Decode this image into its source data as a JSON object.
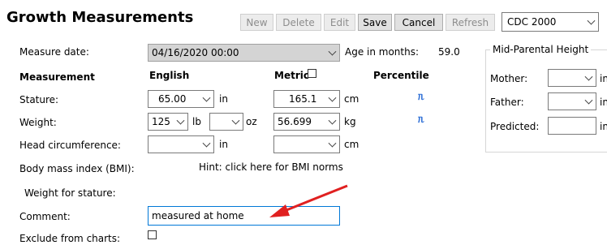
{
  "header": {
    "title": "Growth Measurements"
  },
  "toolbar": {
    "new": "New",
    "delete": "Delete",
    "edit": "Edit",
    "save": "Save",
    "cancel": "Cancel",
    "refresh": "Refresh",
    "standard": "CDC 2000"
  },
  "measure_date": {
    "label": "Measure date:",
    "value": "04/16/2020 00:00",
    "age_label": "Age in months:",
    "age_value": "59.0"
  },
  "columns": {
    "measurement": "Measurement",
    "english": "English",
    "metric": "Metric",
    "percentile": "Percentile"
  },
  "rows": {
    "stature": {
      "label": "Stature:",
      "english_value": "65.00",
      "english_unit": "in",
      "metric_value": "165.1",
      "metric_unit": "cm"
    },
    "weight": {
      "label": "Weight:",
      "english_value": "125",
      "english_unit": "lb",
      "english_value2": "",
      "english_unit2": "oz",
      "metric_value": "56.699",
      "metric_unit": "kg"
    },
    "head": {
      "label": "Head circumference:",
      "english_value": "",
      "english_unit": "in",
      "metric_value": "",
      "metric_unit": "cm"
    },
    "bmi": {
      "label": "Body mass index (BMI):",
      "hint": "Hint: click here for BMI norms"
    },
    "wfs": {
      "label": "Weight for stature:"
    },
    "comment": {
      "label": "Comment:",
      "value": "measured at home"
    },
    "exclude": {
      "label": "Exclude from charts:"
    }
  },
  "mid_parental": {
    "title": "Mid-Parental Height",
    "mother": "Mother:",
    "father": "Father:",
    "predicted": "Predicted:",
    "unit": "in"
  },
  "colors": {
    "annotation_arrow": "#e02020",
    "focus_border": "#0078d7",
    "percentile_icon": "#2e6fd6"
  }
}
